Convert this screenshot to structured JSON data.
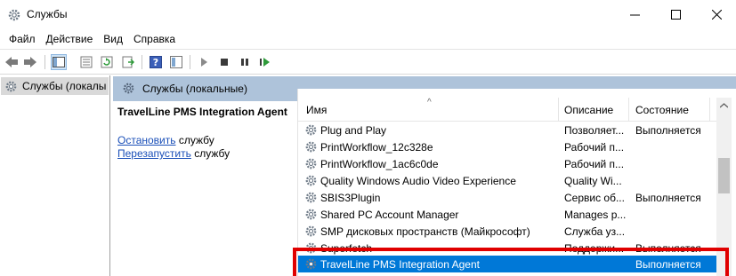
{
  "window": {
    "title": "Службы",
    "controls": {
      "minimize": "minimize",
      "maximize": "maximize",
      "close": "close"
    }
  },
  "menu": [
    "Файл",
    "Действие",
    "Вид",
    "Справка"
  ],
  "toolbar": {
    "buttons": [
      "back-arrow-icon",
      "forward-arrow-icon",
      "console-tree-icon",
      "properties-icon",
      "refresh-icon",
      "export-icon",
      "help-icon",
      "snapin-icon",
      "start-icon",
      "stop-icon",
      "pause-icon",
      "restart-icon"
    ]
  },
  "tree": {
    "root_label": "Службы (локалы"
  },
  "pane": {
    "header": "Службы (локальные)"
  },
  "detail": {
    "service_title": "TravelLine PMS Integration Agent",
    "stop_link": "Остановить",
    "stop_suffix": " службу",
    "restart_link": "Перезапустить",
    "restart_suffix": " службу"
  },
  "table": {
    "columns": {
      "name": "Имя",
      "description": "Описание",
      "state": "Состояние"
    },
    "rows": [
      {
        "name": "Plug and Play",
        "description": "Позволяет...",
        "state": "Выполняется"
      },
      {
        "name": "PrintWorkflow_12c328e",
        "description": "Рабочий п...",
        "state": ""
      },
      {
        "name": "PrintWorkflow_1ac6c0de",
        "description": "Рабочий п...",
        "state": ""
      },
      {
        "name": "Quality Windows Audio Video Experience",
        "description": "Quality Wi...",
        "state": ""
      },
      {
        "name": "SBIS3Plugin",
        "description": "Сервис об...",
        "state": "Выполняется"
      },
      {
        "name": "Shared PC Account Manager",
        "description": "Manages p...",
        "state": ""
      },
      {
        "name": "SMP дисковых пространств (Майкрософт)",
        "description": "Служба уз...",
        "state": ""
      },
      {
        "name": "Superfetch",
        "description": "Поддержи...",
        "state": "Выполняется"
      },
      {
        "name": "TravelLine PMS Integration Agent",
        "description": "",
        "state": "Выполняется",
        "selected": true
      }
    ]
  },
  "colors": {
    "accent_selected": "#0078d7",
    "header_band": "#aec3da",
    "annotation_box": "#e00000",
    "link": "#1a4fb8"
  }
}
